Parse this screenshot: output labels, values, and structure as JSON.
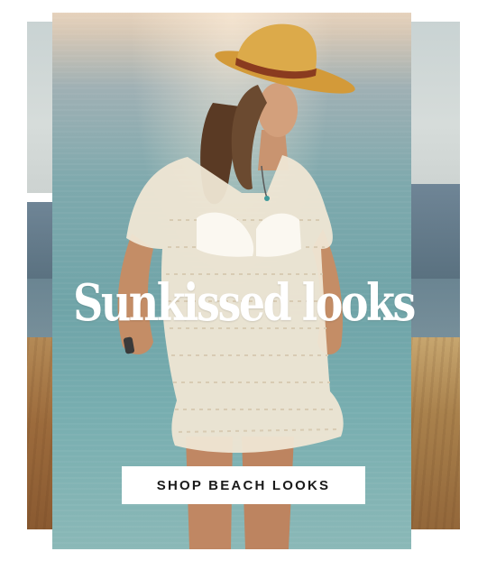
{
  "banner": {
    "headline": "Sunkissed looks",
    "cta_label": "SHOP BEACH LOOKS",
    "hero_image": "woman-in-crochet-beach-coverup-and-hat",
    "colors": {
      "headline": "#ffffff",
      "cta_background": "#ffffff",
      "cta_text": "#1a1a1a",
      "sea": "#6fa4a8",
      "hat": "#d6a03e"
    }
  }
}
